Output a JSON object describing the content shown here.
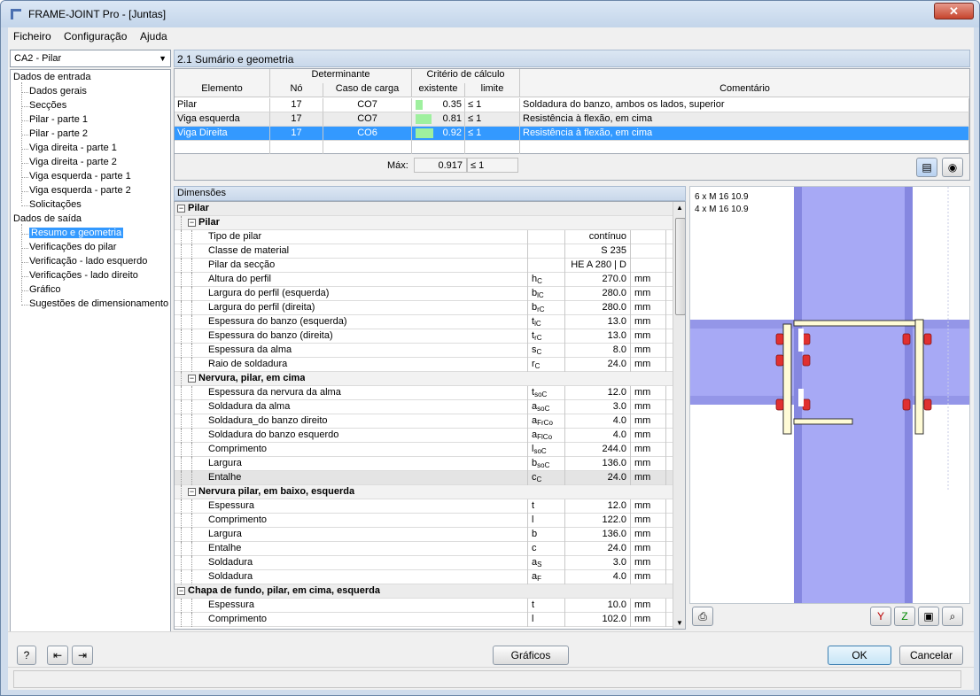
{
  "window": {
    "title": "FRAME-JOINT Pro - [Juntas]",
    "close_label": "✕"
  },
  "menu": [
    "Ficheiro",
    "Configuração",
    "Ajuda"
  ],
  "left": {
    "combo_value": "CA2 - Pilar",
    "input_header": "Dados de entrada",
    "input_items": [
      "Dados gerais",
      "Secções",
      "Pilar - parte 1",
      "Pilar - parte 2",
      "Viga direita - parte 1",
      "Viga direita - parte 2",
      "Viga esquerda - parte 1",
      "Viga esquerda - parte 2",
      "Solicitações"
    ],
    "output_header": "Dados de saída",
    "output_items": [
      "Resumo e geometria",
      "Verificações do pilar",
      "Verificação - lado esquerdo",
      "Verificações - lado direito",
      "Gráfico",
      "Sugestões de dimensionamento"
    ]
  },
  "summary": {
    "header": "2.1 Sumário e geometria",
    "col_determinante": "Determinante",
    "col_criterio": "Critério de cálculo",
    "col_elemento": "Elemento",
    "col_no": "Nó",
    "col_caso": "Caso de carga",
    "col_existente": "existente",
    "col_limite": "limite",
    "col_comentario": "Comentário",
    "rows": [
      {
        "elemento": "Pilar",
        "no": "17",
        "caso": "CO7",
        "existente": "0.35",
        "fill": 0.35,
        "limite": "≤ 1",
        "comentario": "Soldadura do banzo, ambos os lados, superior"
      },
      {
        "elemento": "Viga esquerda",
        "no": "17",
        "caso": "CO7",
        "existente": "0.81",
        "fill": 0.81,
        "limite": "≤ 1",
        "comentario": "Resistência à flexão, em cima"
      },
      {
        "elemento": "Viga Direita",
        "no": "17",
        "caso": "CO6",
        "existente": "0.92",
        "fill": 0.92,
        "limite": "≤ 1",
        "comentario": "Resistência à flexão, em cima"
      }
    ],
    "max_label": "Máx:",
    "max_value": "0.917",
    "max_limit": "≤ 1"
  },
  "dimensions": {
    "header": "Dimensões",
    "rows": [
      {
        "t": "sec",
        "label": "Pilar"
      },
      {
        "t": "sub",
        "label": "Pilar"
      },
      {
        "t": "row",
        "label": "Tipo de pilar",
        "sym": "",
        "sub": "",
        "val": "contínuo",
        "unit": ""
      },
      {
        "t": "row",
        "label": "Classe de material",
        "sym": "",
        "sub": "",
        "val": "S 235",
        "unit": ""
      },
      {
        "t": "row",
        "label": "Pilar da secção",
        "sym": "",
        "sub": "",
        "val": "HE A 280 | D",
        "unit": ""
      },
      {
        "t": "row",
        "label": "Altura do perfil",
        "sym": "h",
        "sub": "C",
        "val": "270.0",
        "unit": "mm"
      },
      {
        "t": "row",
        "label": "Largura do perfil (esquerda)",
        "sym": "b",
        "sub": "lC",
        "val": "280.0",
        "unit": "mm"
      },
      {
        "t": "row",
        "label": "Largura do perfil (direita)",
        "sym": "b",
        "sub": "rC",
        "val": "280.0",
        "unit": "mm"
      },
      {
        "t": "row",
        "label": "Espessura do banzo (esquerda)",
        "sym": "t",
        "sub": "lC",
        "val": "13.0",
        "unit": "mm"
      },
      {
        "t": "row",
        "label": "Espessura do banzo (direita)",
        "sym": "t",
        "sub": "rC",
        "val": "13.0",
        "unit": "mm"
      },
      {
        "t": "row",
        "label": "Espessura da alma",
        "sym": "s",
        "sub": "C",
        "val": "8.0",
        "unit": "mm"
      },
      {
        "t": "row",
        "label": "Raio de soldadura",
        "sym": "r",
        "sub": "C",
        "val": "24.0",
        "unit": "mm"
      },
      {
        "t": "sub",
        "label": "Nervura, pilar, em cima"
      },
      {
        "t": "row",
        "label": "Espessura da nervura da alma",
        "sym": "t",
        "sub": "soC",
        "val": "12.0",
        "unit": "mm"
      },
      {
        "t": "row",
        "label": "Soldadura da alma",
        "sym": "a",
        "sub": "soC",
        "val": "3.0",
        "unit": "mm"
      },
      {
        "t": "row",
        "label": "Soldadura_do banzo direito",
        "sym": "a",
        "sub": "FrCo",
        "val": "4.0",
        "unit": "mm"
      },
      {
        "t": "row",
        "label": "Soldadura do banzo esquerdo",
        "sym": "a",
        "sub": "FlCo",
        "val": "4.0",
        "unit": "mm"
      },
      {
        "t": "row",
        "label": "Comprimento",
        "sym": "l",
        "sub": "soC",
        "val": "244.0",
        "unit": "mm"
      },
      {
        "t": "row",
        "label": "Largura",
        "sym": "b",
        "sub": "soC",
        "val": "136.0",
        "unit": "mm"
      },
      {
        "t": "grey",
        "label": "Entalhe",
        "sym": "c",
        "sub": "C",
        "val": "24.0",
        "unit": "mm"
      },
      {
        "t": "sub",
        "label": "Nervura pilar, em baixo, esquerda"
      },
      {
        "t": "row",
        "label": "Espessura",
        "sym": "t",
        "sub": "",
        "val": "12.0",
        "unit": "mm"
      },
      {
        "t": "row",
        "label": "Comprimento",
        "sym": "l",
        "sub": "",
        "val": "122.0",
        "unit": "mm"
      },
      {
        "t": "row",
        "label": "Largura",
        "sym": "b",
        "sub": "",
        "val": "136.0",
        "unit": "mm"
      },
      {
        "t": "row",
        "label": "Entalhe",
        "sym": "c",
        "sub": "",
        "val": "24.0",
        "unit": "mm"
      },
      {
        "t": "row",
        "label": "Soldadura",
        "sym": "a",
        "sub": "S",
        "val": "3.0",
        "unit": "mm"
      },
      {
        "t": "row",
        "label": "Soldadura",
        "sym": "a",
        "sub": "F",
        "val": "4.0",
        "unit": "mm"
      },
      {
        "t": "sec",
        "label": "Chapa de fundo, pilar, em cima, esquerda"
      },
      {
        "t": "row",
        "label": "Espessura",
        "sym": "t",
        "sub": "",
        "val": "10.0",
        "unit": "mm"
      },
      {
        "t": "row",
        "label": "Comprimento",
        "sym": "l",
        "sub": "",
        "val": "102.0",
        "unit": "mm"
      }
    ]
  },
  "graphic": {
    "bolt_line1": "6 x M 16 10.9",
    "bolt_line2": "4 x M 16 10.9"
  },
  "buttons": {
    "graficos": "Gráficos",
    "ok": "OK",
    "cancelar": "Cancelar"
  },
  "colors": {
    "selection": "#3399ff",
    "utilization_bar": "#9ff09f",
    "steel": "#a7a9f5",
    "plate": "#fffbd6",
    "bolt": "#e03030"
  }
}
